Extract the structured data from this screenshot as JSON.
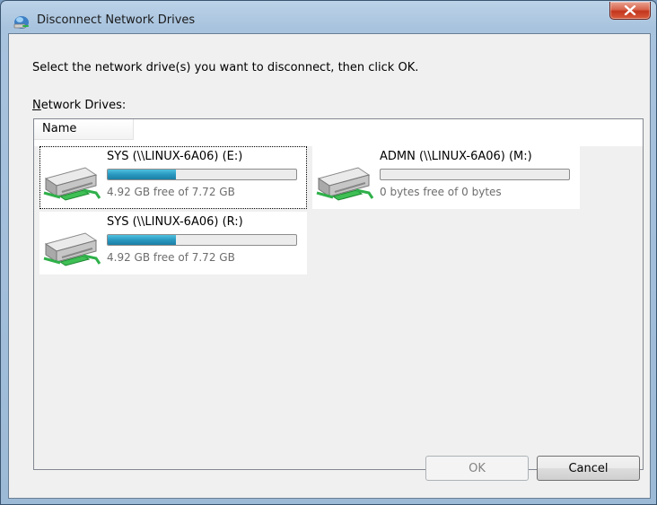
{
  "window": {
    "title": "Disconnect Network Drives",
    "close_label": "Close"
  },
  "dialog": {
    "instruction": "Select the network drive(s) you want to disconnect, then click OK.",
    "list_label_mnemonic": "N",
    "list_label_rest": "etwork Drives:",
    "column_header": "Name"
  },
  "drives": [
    {
      "name": "SYS (\\\\LINUX-6A06) (E:)",
      "free_text": "4.92 GB free of 7.72 GB",
      "used_fraction": 0.363,
      "focused": true
    },
    {
      "name": "ADMN (\\\\LINUX-6A06) (M:)",
      "free_text": "0 bytes free of 0 bytes",
      "used_fraction": 0.0,
      "focused": false
    },
    {
      "name": "SYS (\\\\LINUX-6A06) (R:)",
      "free_text": "4.92 GB free of 7.72 GB",
      "used_fraction": 0.363,
      "focused": false
    }
  ],
  "buttons": {
    "ok": "OK",
    "ok_enabled": false,
    "cancel": "Cancel"
  },
  "colors": {
    "usage_bar": "#2a98c0",
    "close_button": "#c2361d",
    "network_cable": "#2fb04a"
  }
}
